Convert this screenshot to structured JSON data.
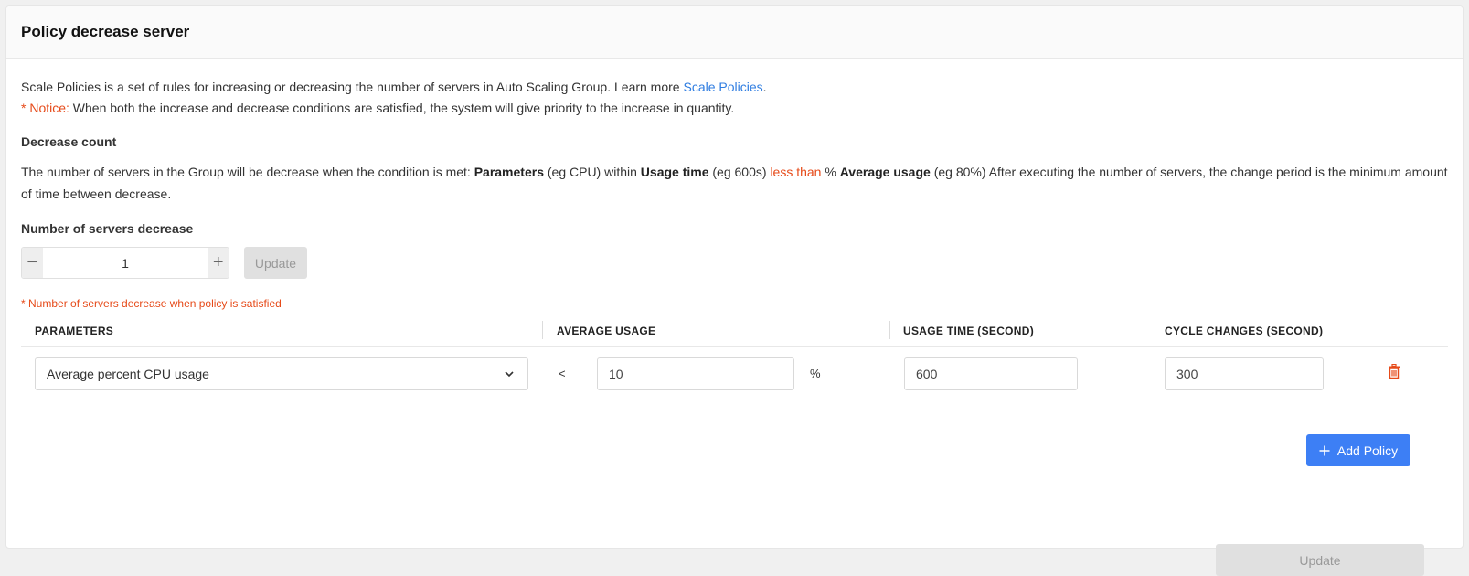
{
  "header": {
    "title": "Policy decrease server"
  },
  "intro": {
    "line1_text": "Scale Policies is a set of rules for increasing or decreasing the number of servers in Auto Scaling Group. Learn more",
    "line1_link": "Scale Policies",
    "line1_end": ".",
    "notice_label": "* Notice:",
    "notice_text": " When both the increase and decrease conditions are satisfied, the system will give priority to the increase in quantity."
  },
  "decrease": {
    "title": "Decrease count",
    "desc_p1": "The number of servers in the Group will be decrease when the condition is met: ",
    "desc_b1": "Parameters",
    "desc_p2": " (eg CPU) within ",
    "desc_b2": "Usage time",
    "desc_p3": " (eg 600s) ",
    "desc_red": "less than",
    "desc_p4": " % ",
    "desc_b3": "Average usage",
    "desc_p5": " (eg 80%) After executing the number of servers, the change period is the minimum amount of time between decrease."
  },
  "servers": {
    "label": "Number of servers decrease",
    "value": "1",
    "minus": "−",
    "plus": "+",
    "update_label": "Update",
    "hint": "* Number of servers decrease when policy is satisfied"
  },
  "table": {
    "headers": [
      "PARAMETERS",
      "AVERAGE USAGE",
      "USAGE TIME (SECOND)",
      "CYCLE CHANGES (SECOND)"
    ],
    "rows": [
      {
        "parameter": "Average percent CPU usage",
        "operator": "<",
        "average_usage": "10",
        "unit": "%",
        "usage_time": "600",
        "cycle_changes": "300"
      }
    ]
  },
  "add_policy_label": "Add Policy",
  "footer": {
    "update_label": "Update"
  },
  "colors": {
    "accent": "#3d7ff5",
    "link": "#2f7de1",
    "warning": "#e64a19",
    "disabled": "#e0e0e0"
  }
}
